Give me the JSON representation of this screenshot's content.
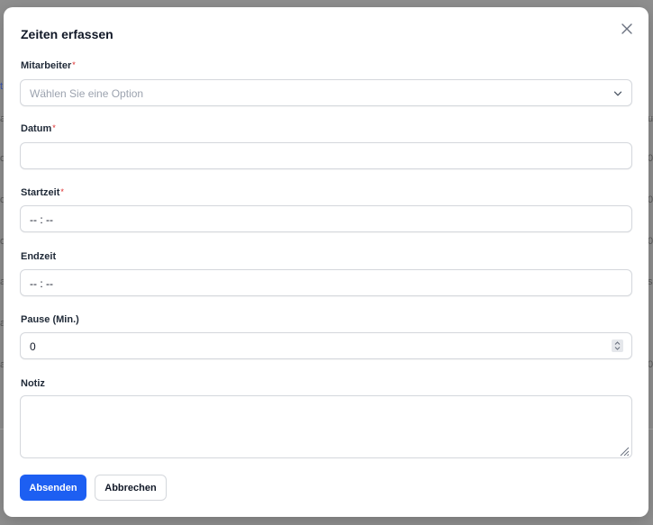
{
  "background": {
    "edge_glyphs": [
      "a",
      "o",
      "o",
      "o",
      "a",
      "a",
      "a"
    ],
    "right_glyphs": [
      "u",
      "0",
      "0",
      "0",
      "s",
      "0"
    ]
  },
  "dialog": {
    "title": "Zeiten erfassen",
    "required_mark": "*",
    "fields": {
      "employee": {
        "label": "Mitarbeiter",
        "placeholder": "Wählen Sie eine Option"
      },
      "date": {
        "label": "Datum",
        "value": ""
      },
      "start": {
        "label": "Startzeit",
        "value": "-- : --"
      },
      "end": {
        "label": "Endzeit",
        "value": "-- : --"
      },
      "pause": {
        "label": "Pause (Min.)",
        "value": "0"
      },
      "note": {
        "label": "Notiz",
        "value": ""
      }
    },
    "buttons": {
      "submit": "Absenden",
      "cancel": "Abbrechen"
    }
  },
  "colors": {
    "primary": "#1d5ff2",
    "required": "#dc2626",
    "overlay": "#8f8f8f"
  },
  "icons": {
    "close": "close-icon",
    "dropdown": "chevron-down-icon",
    "spinner": "stepper-icon",
    "resize": "resize-handle-icon"
  }
}
